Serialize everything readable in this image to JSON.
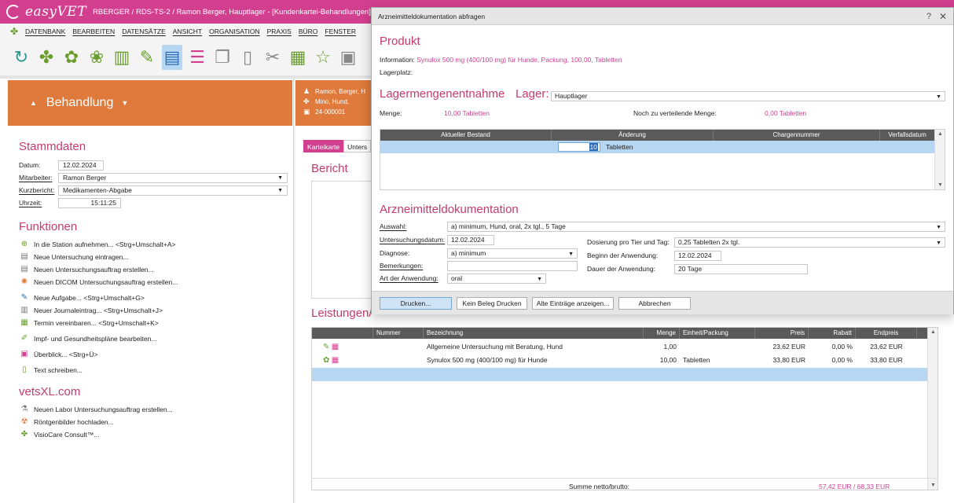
{
  "window": {
    "brand": "easyVET",
    "title": "RBERGER / RDS-TS-2 / Ramon Berger, Hauptlager - [Kundenkartei-Behandlungen]"
  },
  "menu": [
    "DATENBANK",
    "BEARBEITEN",
    "DATENSÄTZE",
    "ANSICHT",
    "ORGANISATION",
    "PRAXIS",
    "BÜRO",
    "FENSTER"
  ],
  "left": {
    "header": "Behandlung",
    "stammdaten": {
      "title": "Stammdaten",
      "datum_label": "Datum:",
      "datum": "12.02.2024",
      "mitarbeiter_label": "Mitarbeiter:",
      "mitarbeiter": "Ramon Berger",
      "kurzbericht_label": "Kurzbericht:",
      "kurzbericht": "Medikamenten-Abgabe",
      "uhrzeit_label": "Uhrzeit:",
      "uhrzeit": "15:11:25"
    },
    "funktionen": {
      "title": "Funktionen",
      "items": [
        "In die Station aufnehmen... <Strg+Umschalt+A>",
        "Neue Untersuchung eintragen...",
        "Neuen Untersuchungsauftrag erstellen...",
        "Neuen DICOM Untersuchungsauftrag erstellen...",
        "Neue Aufgabe... <Strg+Umschalt+G>",
        "Neuer Journaleintrag... <Strg+Umschalt+J>",
        "Termin vereinbaren... <Strg+Umschalt+K>",
        "Impf- und Gesundheitspläne bearbeiten...",
        "Überblick... <Strg+Ü>",
        "Text schreiben..."
      ]
    },
    "vetsxl": {
      "title": "vetsXL.com",
      "items": [
        "Neuen Labor Untersuchungsauftrag erstellen...",
        "Röntgenbilder hochladen...",
        "VisioCare Consult™..."
      ]
    }
  },
  "middle": {
    "header_lines": [
      "Ramon, Berger, H",
      "Mino, Hund,",
      "24-000001"
    ],
    "tabs": [
      "Karteikarte",
      "Unters"
    ],
    "bericht_title": "Bericht",
    "leistungen_title": "Leistungen/",
    "table": {
      "headers": [
        "Nummer",
        "Bezeichnung",
        "Menge",
        "Einheit/Packung",
        "Preis",
        "Rabatt",
        "Endpreis"
      ],
      "rows": [
        {
          "bezeichnung": "Allgemeine Untersuchung mit Beratung, Hund",
          "menge": "1,00",
          "einheit": "",
          "preis": "23,62 EUR",
          "rabatt": "0,00 %",
          "endpreis": "23,62 EUR"
        },
        {
          "bezeichnung": "Synulox 500 mg (400/100 mg) für Hunde",
          "menge": "10,00",
          "einheit": "Tabletten",
          "preis": "33,80 EUR",
          "rabatt": "0,00 %",
          "endpreis": "33,80 EUR"
        }
      ],
      "sum_label": "Summe netto/brutto:",
      "sum_value": "57,42 EUR / 68,33 EUR"
    }
  },
  "dialog": {
    "title": "Arzneimitteldokumentation abfragen",
    "help": "?",
    "close": "✕",
    "produkt_title": "Produkt",
    "information_label": "Information:",
    "information": "Synulox 500 mg (400/100 mg) für Hunde, Packung, 100,00, Tabletten",
    "lagerplatz_label": "Lagerplatz:",
    "lagerentnahme_title": "Lagermengenentnahme",
    "lager_label": "Lager:",
    "lager_value": "Hauptlager",
    "menge_label": "Menge:",
    "menge_value": "10,00 Tabletten",
    "rest_label": "Noch zu verteilende Menge:",
    "rest_value": "0,00 Tabletten",
    "table_headers": [
      "Aktueller Bestand",
      "Änderung",
      "Chargennummer",
      "Verfallsdatum"
    ],
    "row_qty": "10",
    "row_unit": "Tabletten",
    "amd_title": "Arzneimitteldokumentation",
    "auswahl_label": "Auswahl:",
    "auswahl_value": "a) minimum, Hund, oral, 2x tgl., 5 Tage",
    "udatum_label": "Untersuchungsdatum:",
    "udatum_value": "12.02.2024",
    "diagnose_label": "Diagnose:",
    "diagnose_value": "a) minimum",
    "bemerkungen_label": "Bemerkungen:",
    "bemerkungen_value": "",
    "art_label": "Art der Anwendung:",
    "art_value": "oral",
    "dosierung_label": "Dosierung pro Tier und Tag:",
    "dosierung_value": "0,25 Tabletten 2x tgl.",
    "beginn_label": "Beginn der Anwendung:",
    "beginn_value": "12.02.2024",
    "dauer_label": "Dauer der Anwendung:",
    "dauer_value": "20 Tage",
    "buttons": {
      "drucken": "Drucken...",
      "kein_beleg": "Kein Beleg Drucken",
      "alte": "Alte Einträge anzeigen...",
      "abbrechen": "Abbrechen"
    }
  }
}
